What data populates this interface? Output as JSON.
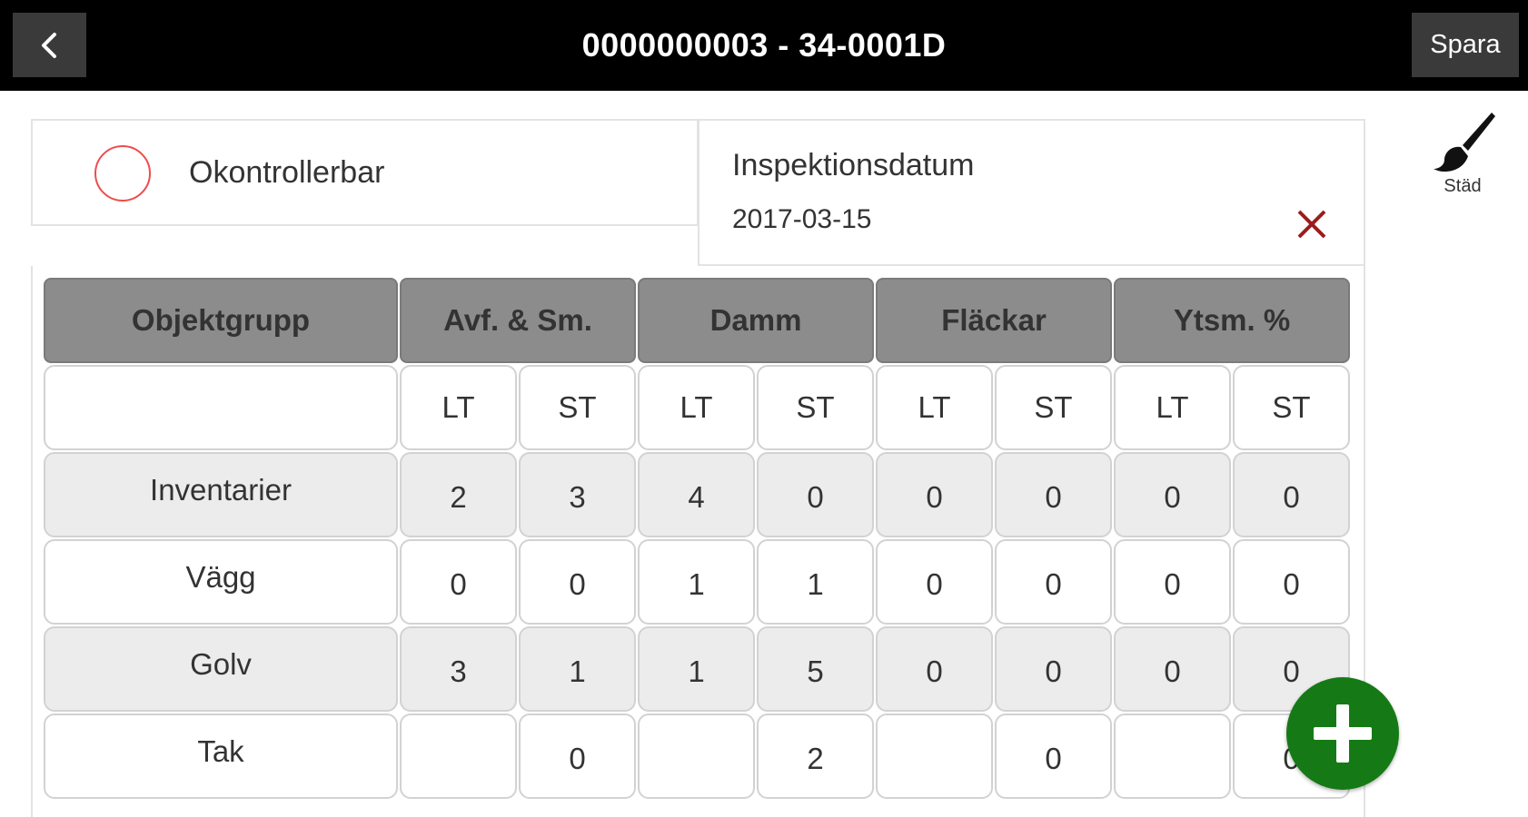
{
  "header": {
    "title": "0000000003 - 34-0001D",
    "back_icon": "chevron-left-icon",
    "save_label": "Spara"
  },
  "tool": {
    "label": "Städ",
    "icon": "paintbrush-icon"
  },
  "status": {
    "label": "Okontrollerbar",
    "circle_color": "#ee4c4c"
  },
  "inspection": {
    "label": "Inspektionsdatum",
    "date": "2017-03-15",
    "clear_icon": "close-icon",
    "clear_color": "#9b1c1c"
  },
  "table": {
    "headers": [
      "Objektgrupp",
      "Avf. & Sm.",
      "Damm",
      "Fläckar",
      "Ytsm. %"
    ],
    "subheaders": [
      "LT",
      "ST",
      "LT",
      "ST",
      "LT",
      "ST",
      "LT",
      "ST"
    ],
    "rows": [
      {
        "name": "Inventarier",
        "values": [
          "2",
          "3",
          "4",
          "0",
          "0",
          "0",
          "0",
          "0"
        ]
      },
      {
        "name": "Vägg",
        "values": [
          "0",
          "0",
          "1",
          "1",
          "0",
          "0",
          "0",
          "0"
        ]
      },
      {
        "name": "Golv",
        "values": [
          "3",
          "1",
          "1",
          "5",
          "0",
          "0",
          "0",
          "0"
        ]
      },
      {
        "name": "Tak",
        "values": [
          "",
          "0",
          "",
          "2",
          "",
          "0",
          "",
          "0"
        ]
      }
    ]
  },
  "fab": {
    "icon": "plus-icon",
    "color": "#157a15"
  }
}
